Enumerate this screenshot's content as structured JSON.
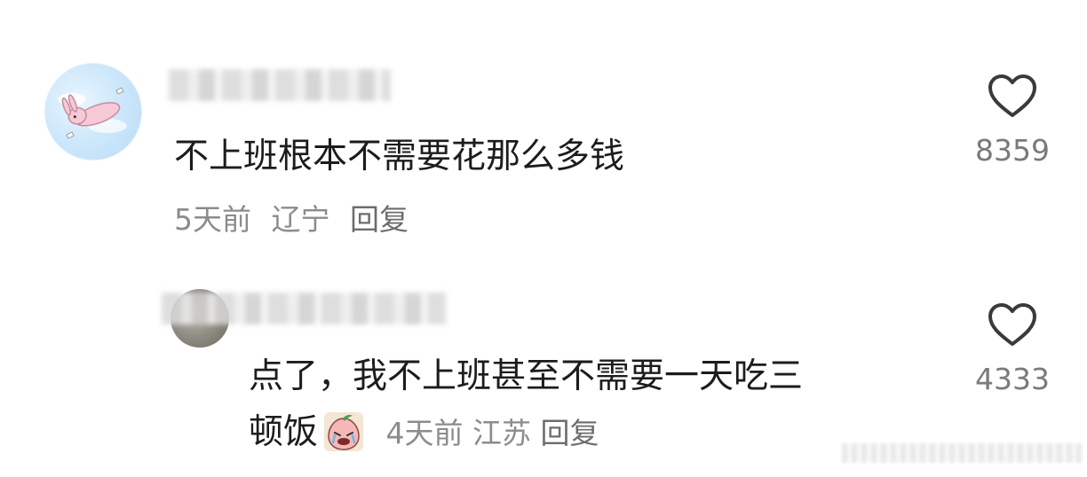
{
  "comments": [
    {
      "text": "不上班根本不需要花那么多钱",
      "time": "5天前",
      "location": "辽宁",
      "reply_label": "回复",
      "likes": "8359"
    },
    {
      "text_line1": "点了，我不上班甚至不需要一天吃三",
      "text_line2": "顿饭",
      "time": "4天前",
      "location": "江苏",
      "reply_label": "回复",
      "likes": "4333"
    }
  ],
  "icons": {
    "like": "heart-outline-icon",
    "emoji": "crying-peach-emoji"
  }
}
